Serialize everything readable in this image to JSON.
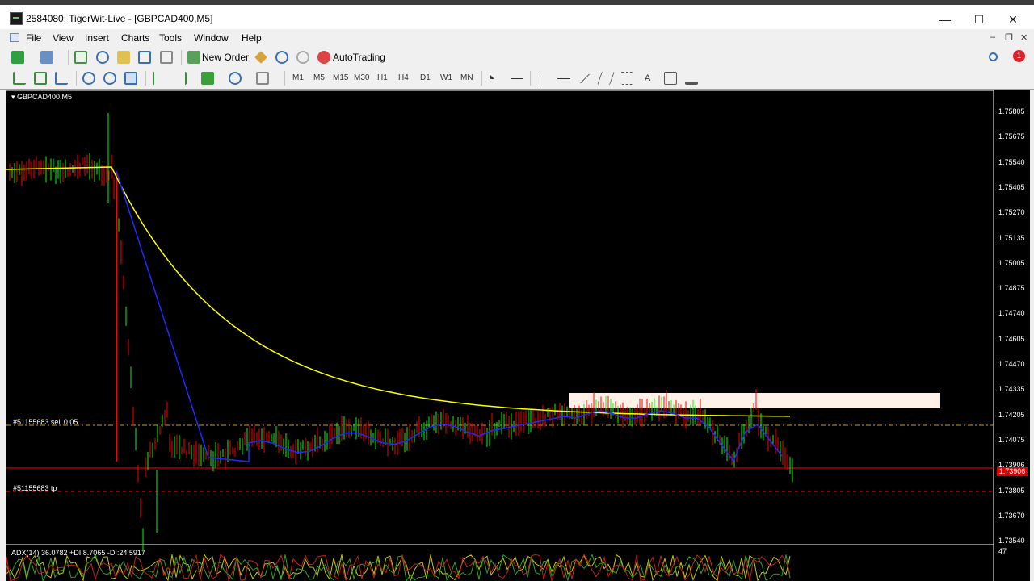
{
  "window": {
    "title": "2584080: TigerWit-Live - [GBPCAD400,M5]",
    "minimize": "—",
    "maximize": "☐",
    "close": "✕"
  },
  "menu": {
    "items": [
      "File",
      "View",
      "Insert",
      "Charts",
      "Tools",
      "Window",
      "Help"
    ],
    "mdi_minimize": "–",
    "mdi_restore": "❐",
    "mdi_close": "✕"
  },
  "toolbar1": {
    "new_order": "New Order",
    "auto_trading": "AutoTrading",
    "notification_count": "1"
  },
  "toolbar2": {
    "timeframes": [
      "M1",
      "M5",
      "M15",
      "M30",
      "H1",
      "H4",
      "D1",
      "W1",
      "MN"
    ],
    "text_tool": "A"
  },
  "chart": {
    "symbol": "GBPCAD400,M5",
    "price_axis": [
      "1.75805",
      "1.75675",
      "1.75540",
      "1.75405",
      "1.75270",
      "1.75135",
      "1.75005",
      "1.74875",
      "1.74740",
      "1.74605",
      "1.74470",
      "1.74335",
      "1.74205",
      "1.74075",
      "1.73906",
      "1.73805",
      "1.73670",
      "1.73540"
    ],
    "current_price": "1.73906",
    "order_sell_label": "#51155683 sell 0.05",
    "order_tp_label": "#51155683 tp",
    "adx_label": "ADX(14) 36.0782 +DI:8.7065 -DI:24.5917",
    "adx_axis_top": "47",
    "colors": {
      "background": "#000000",
      "bull_candle": "#00ff00",
      "bear_candle": "#ff0000",
      "moving_average": "#ffff00",
      "second_ma": "#1c2cff",
      "order_line": "#ff0000",
      "zone_rect": "#fff0e8"
    }
  }
}
